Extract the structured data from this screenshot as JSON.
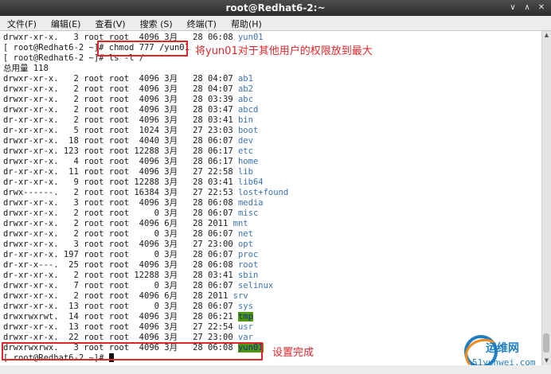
{
  "window": {
    "title": "root@Redhat6-2:~",
    "controls": [
      "∨",
      "∧",
      "✕"
    ]
  },
  "menu": [
    "文件(F)",
    "编辑(E)",
    "查看(V)",
    "搜索 (S)",
    "终端(T)",
    "帮助(H)"
  ],
  "terminal": {
    "lines": [
      [
        "drwxr-xr-x.   3 root root  4096 3月   28 06:08 ",
        "yun01",
        "dir"
      ],
      [
        "[ root@Redhat6-2 ~]# ",
        "chmod 777 /yun01",
        "plain"
      ],
      [
        "[ root@Redhat6-2 ~]# ",
        "ls -l /",
        "plain"
      ],
      [
        "总用量 118",
        "",
        "plain"
      ],
      [
        "drwxr-xr-x.   2 root root  4096 3月   28 04:07 ",
        "ab1",
        "dir"
      ],
      [
        "drwxr-xr-x.   2 root root  4096 3月   28 04:07 ",
        "ab2",
        "dir"
      ],
      [
        "drwxr-xr-x.   2 root root  4096 3月   28 03:39 ",
        "abc",
        "dir"
      ],
      [
        "drwxr-xr-x.   2 root root  4096 3月   28 03:47 ",
        "abcd",
        "dir"
      ],
      [
        "dr-xr-xr-x.   2 root root  4096 3月   28 03:41 ",
        "bin",
        "dir"
      ],
      [
        "dr-xr-xr-x.   5 root root  1024 3月   27 23:03 ",
        "boot",
        "dir"
      ],
      [
        "drwxr-xr-x.  18 root root  4040 3月   28 06:07 ",
        "dev",
        "dir"
      ],
      [
        "drwxr-xr-x. 123 root root 12288 3月   28 06:17 ",
        "etc",
        "dir"
      ],
      [
        "drwxr-xr-x.   4 root root  4096 3月   28 06:17 ",
        "home",
        "dir"
      ],
      [
        "dr-xr-xr-x.  11 root root  4096 3月   27 22:58 ",
        "lib",
        "dir"
      ],
      [
        "dr-xr-xr-x.   9 root root 12288 3月   28 03:41 ",
        "lib64",
        "dir"
      ],
      [
        "drwx------.   2 root root 16384 3月   27 22:53 ",
        "lost+found",
        "dir"
      ],
      [
        "drwxr-xr-x.   3 root root  4096 3月   28 06:08 ",
        "media",
        "dir"
      ],
      [
        "drwxr-xr-x.   2 root root     0 3月   28 06:07 ",
        "misc",
        "dir"
      ],
      [
        "drwxr-xr-x.   2 root root  4096 6月   28 2011 ",
        "mnt",
        "dir"
      ],
      [
        "drwxr-xr-x.   2 root root     0 3月   28 06:07 ",
        "net",
        "dir"
      ],
      [
        "drwxr-xr-x.   3 root root  4096 3月   27 23:00 ",
        "opt",
        "dir"
      ],
      [
        "dr-xr-xr-x. 197 root root     0 3月   28 06:07 ",
        "proc",
        "dir"
      ],
      [
        "dr-xr-x---.  25 root root  4096 3月   28 06:08 ",
        "root",
        "dir"
      ],
      [
        "dr-xr-xr-x.   2 root root 12288 3月   28 03:41 ",
        "sbin",
        "dir"
      ],
      [
        "drwxr-xr-x.   7 root root     0 3月   28 06:07 ",
        "selinux",
        "dir"
      ],
      [
        "drwxr-xr-x.   2 root root  4096 6月   28 2011 ",
        "srv",
        "dir"
      ],
      [
        "drwxr-xr-x.  13 root root     0 3月   28 06:07 ",
        "sys",
        "dir"
      ],
      [
        "drwxrwxrwt.  14 root root  4096 3月   28 06:21 ",
        "tmp",
        "hl"
      ],
      [
        "drwxr-xr-x.  13 root root  4096 3月   27 22:54 ",
        "usr",
        "dir"
      ],
      [
        "drwxr-xr-x.  22 root root  4096 3月   27 23:00 ",
        "var",
        "dir"
      ],
      [
        "drwxrwxrwx.   3 root root  4096 3月   28 06:08 ",
        "yun01",
        "hl"
      ],
      [
        "[ root@Redhat6-2 ~]# ",
        "",
        "cursor"
      ]
    ]
  },
  "annotations": {
    "chmod_note": "将yun01对于其他用户的权限放到最大",
    "done_note": "设置完成"
  },
  "watermark": {
    "text": "运维网",
    "site": "51yunwei.com"
  },
  "colors": {
    "annotation": "#e0262b",
    "dir": "#3d73b8",
    "highlight_bg": "#4e9a06",
    "highlight_fg": "#1b2b9a"
  },
  "icons": [
    "minimize-icon",
    "maximize-icon",
    "close-icon",
    "scroll-up-icon",
    "scroll-down-icon"
  ]
}
